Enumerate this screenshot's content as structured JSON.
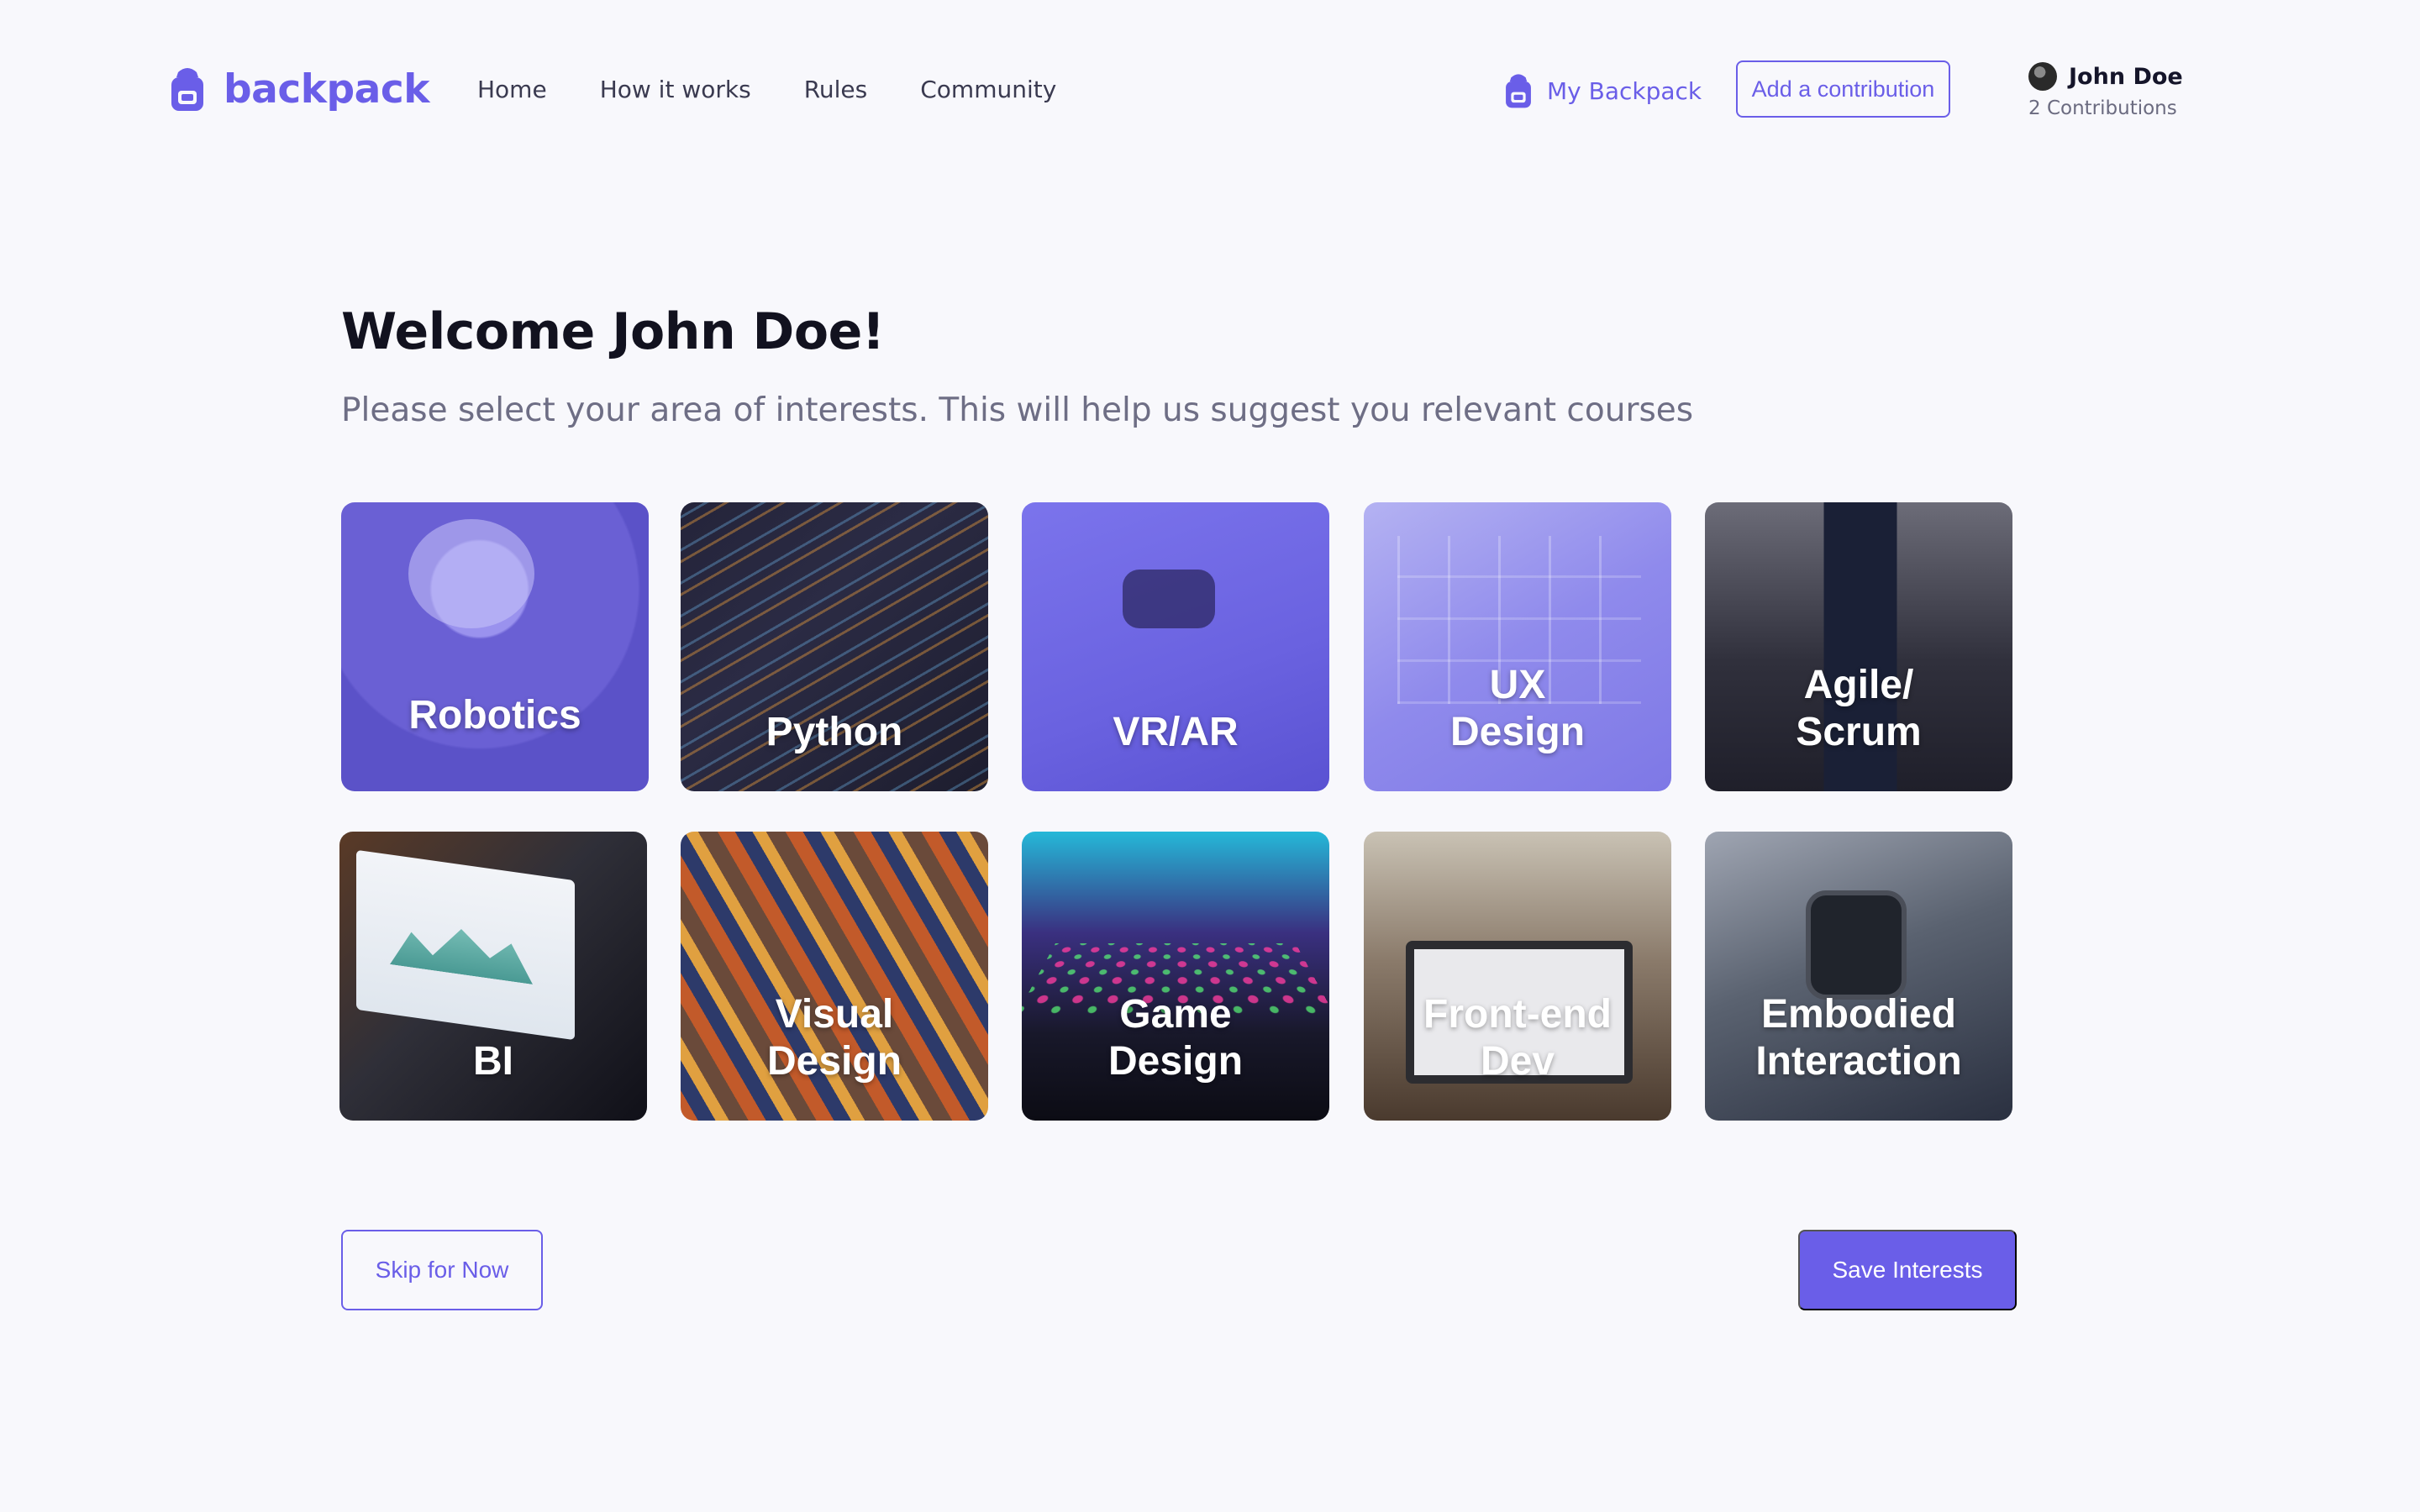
{
  "brand": {
    "name": "backpack",
    "icon": "backpack-icon",
    "color": "#6a5ee8"
  },
  "nav": {
    "items": [
      {
        "label": "Home"
      },
      {
        "label": "How it works"
      },
      {
        "label": "Rules"
      },
      {
        "label": "Community"
      }
    ]
  },
  "header": {
    "my_backpack_label": "My Backpack",
    "add_contribution_label": "Add a contribution",
    "user": {
      "name": "John Doe",
      "contributions": "2 Contributions"
    }
  },
  "main": {
    "title": "Welcome John Doe!",
    "subtitle": "Please select your area of interests. This will help us suggest you relevant courses",
    "interests": [
      {
        "label": "Robotics"
      },
      {
        "label": "Python"
      },
      {
        "label": "VR/AR"
      },
      {
        "label": "UX\nDesign"
      },
      {
        "label": "Agile/\nScrum"
      },
      {
        "label": "BI"
      },
      {
        "label": "Visual\nDesign"
      },
      {
        "label": "Game\nDesign"
      },
      {
        "label": "Front-end\nDev"
      },
      {
        "label": "Embodied\nInteraction"
      }
    ]
  },
  "actions": {
    "skip_label": "Skip for Now",
    "save_label": "Save Interests"
  },
  "colors": {
    "accent": "#6a5ee8",
    "background": "#f8f8fc",
    "heading": "#12121f",
    "muted": "#6e6e85"
  }
}
